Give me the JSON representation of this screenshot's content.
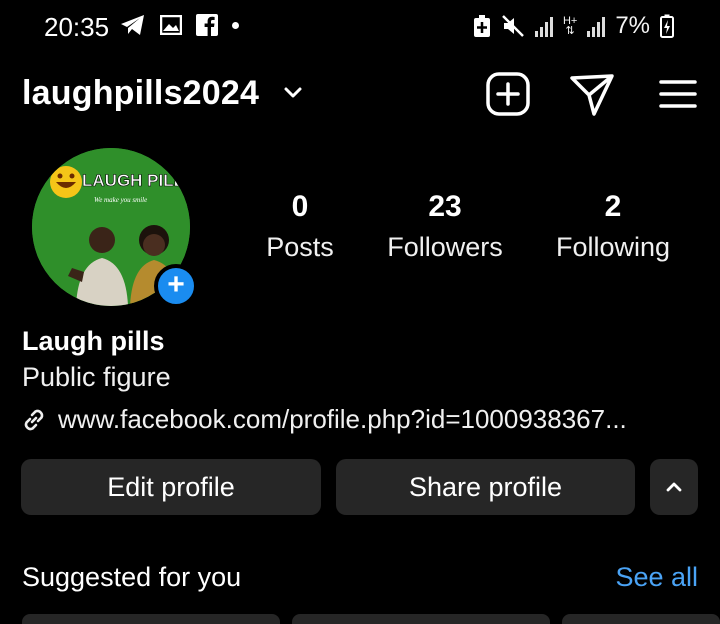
{
  "status_bar": {
    "time": "20:35",
    "battery": "7%",
    "left_icons": [
      "telegram-icon",
      "gallery-icon",
      "facebook-icon",
      "dot-icon"
    ],
    "right_icons": [
      "battery-saver-icon",
      "mute-icon",
      "signal-icon",
      "data-icon",
      "signal-icon-2",
      "charging-battery-icon"
    ]
  },
  "header": {
    "username": "laughpills2024",
    "actions": [
      "create-post-icon",
      "direct-message-icon",
      "menu-icon"
    ]
  },
  "avatar": {
    "logo_text": "LAUGH PILLS",
    "tagline": "We make you smile"
  },
  "stats": [
    {
      "value": "0",
      "label": "Posts"
    },
    {
      "value": "23",
      "label": "Followers"
    },
    {
      "value": "2",
      "label": "Following"
    }
  ],
  "bio": {
    "name": "Laugh pills",
    "category": "Public figure",
    "link": "www.facebook.com/profile.php?id=1000938367..."
  },
  "buttons": {
    "edit": "Edit profile",
    "share": "Share profile"
  },
  "suggested": {
    "title": "Suggested for you",
    "see_all": "See all"
  },
  "colors": {
    "background": "#000000",
    "button": "#262626",
    "accent_blue": "#4aa3f5",
    "avatar_green": "#2f8f2a"
  }
}
